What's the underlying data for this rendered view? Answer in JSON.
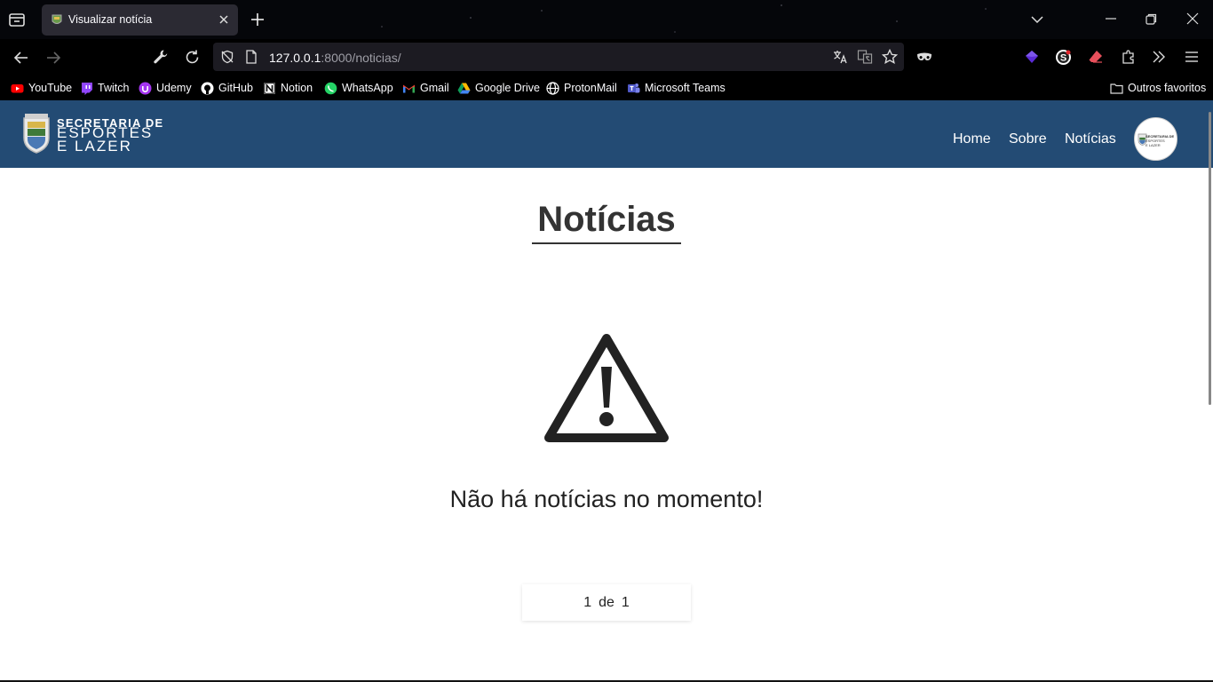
{
  "browser": {
    "tab_title": "Visualizar notícia",
    "url_host": "127.0.0.1",
    "url_rest": ":8000/noticias/",
    "bookmarks": [
      {
        "label": "YouTube",
        "icon": "youtube-icon"
      },
      {
        "label": "Twitch",
        "icon": "twitch-icon"
      },
      {
        "label": "Udemy",
        "icon": "udemy-icon"
      },
      {
        "label": "GitHub",
        "icon": "github-icon"
      },
      {
        "label": "Notion",
        "icon": "notion-icon"
      },
      {
        "label": "WhatsApp",
        "icon": "whatsapp-icon"
      },
      {
        "label": "Gmail",
        "icon": "gmail-icon"
      },
      {
        "label": "Google Drive",
        "icon": "google-drive-icon"
      },
      {
        "label": "ProtonMail",
        "icon": "protonmail-icon"
      },
      {
        "label": "Microsoft Teams",
        "icon": "teams-icon"
      }
    ],
    "other_bookmarks": "Outros favoritos"
  },
  "site": {
    "brand_line1": "SECRETARIA DE",
    "brand_line2": "ESPORTES",
    "brand_line3": "E LAZER",
    "nav": {
      "home": "Home",
      "about": "Sobre",
      "news": "Notícias"
    },
    "header_color": "#234b74"
  },
  "main": {
    "title": "Notícias",
    "empty_message": "Não há notícias no momento!",
    "empty_icon": "warning-triangle-icon",
    "pagination": {
      "current": "1",
      "separator": "de",
      "total": "1"
    }
  }
}
